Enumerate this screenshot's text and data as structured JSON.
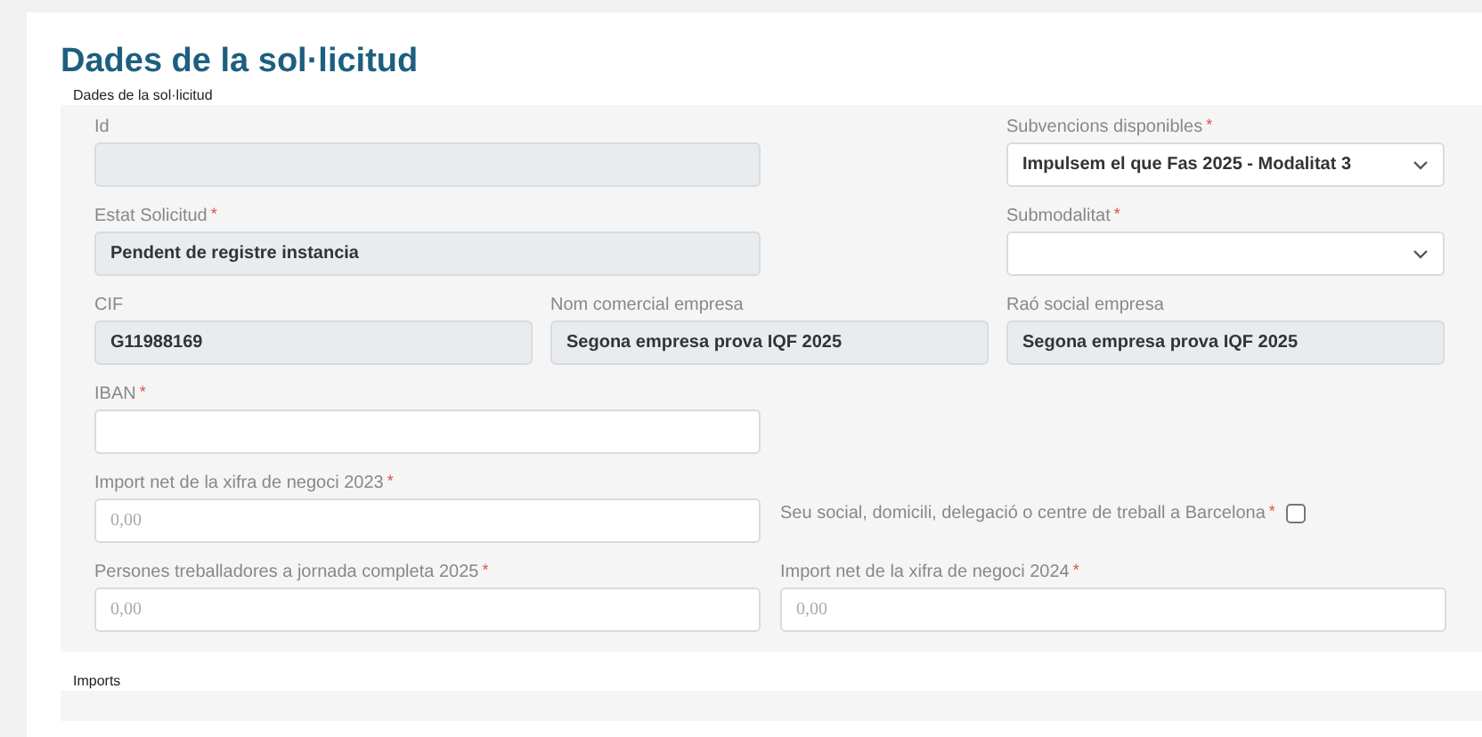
{
  "title": "Dades de la sol·licitud",
  "sections": [
    {
      "legend": "Dades de la sol·licitud",
      "rows": [
        [
          {
            "kind": "text",
            "label": "Id",
            "disabled": true
          },
          {
            "kind": "select",
            "label": "Subvencions disponibles",
            "required_mark": "*",
            "value": "Impulsem el que Fas 2025 - Modalitat 3"
          }
        ],
        [
          {
            "kind": "text",
            "label": "Estat Solicitud",
            "required_mark": "*",
            "value": "Pendent de registre instancia",
            "disabled": true
          },
          {
            "kind": "select",
            "label": "Submodalitat",
            "required_mark": "*"
          }
        ],
        [
          {
            "kind": "text",
            "label": "CIF",
            "value": "G11988169",
            "disabled": true
          },
          {
            "kind": "text",
            "label": "Nom comercial empresa",
            "value": "Segona empresa prova IQF 2025",
            "disabled": true
          },
          {
            "kind": "text",
            "label": "Raó social empresa",
            "value": "Segona empresa prova IQF 2025",
            "disabled": true
          }
        ],
        [
          {
            "kind": "text",
            "label": "IBAN",
            "required_mark": "*",
            "disabled": false
          }
        ],
        [
          {
            "kind": "text",
            "label": "Import net de la xifra de negoci 2023",
            "required_mark": "*",
            "placeholder": "0,00",
            "disabled": false
          },
          {
            "kind": "checkbox",
            "label": "Seu social, domicili, delegació o centre de treball a Barcelona",
            "required_mark": "*",
            "checked": false
          }
        ],
        [
          {
            "kind": "text",
            "label": "Persones treballadores a jornada completa 2025",
            "required_mark": "*",
            "placeholder": "0,00",
            "disabled": false
          },
          {
            "kind": "text",
            "label": "Import net de la xifra de negoci 2024",
            "required_mark": "*",
            "placeholder": "0,00",
            "disabled": false
          }
        ]
      ]
    },
    {
      "legend": "Imports"
    }
  ]
}
